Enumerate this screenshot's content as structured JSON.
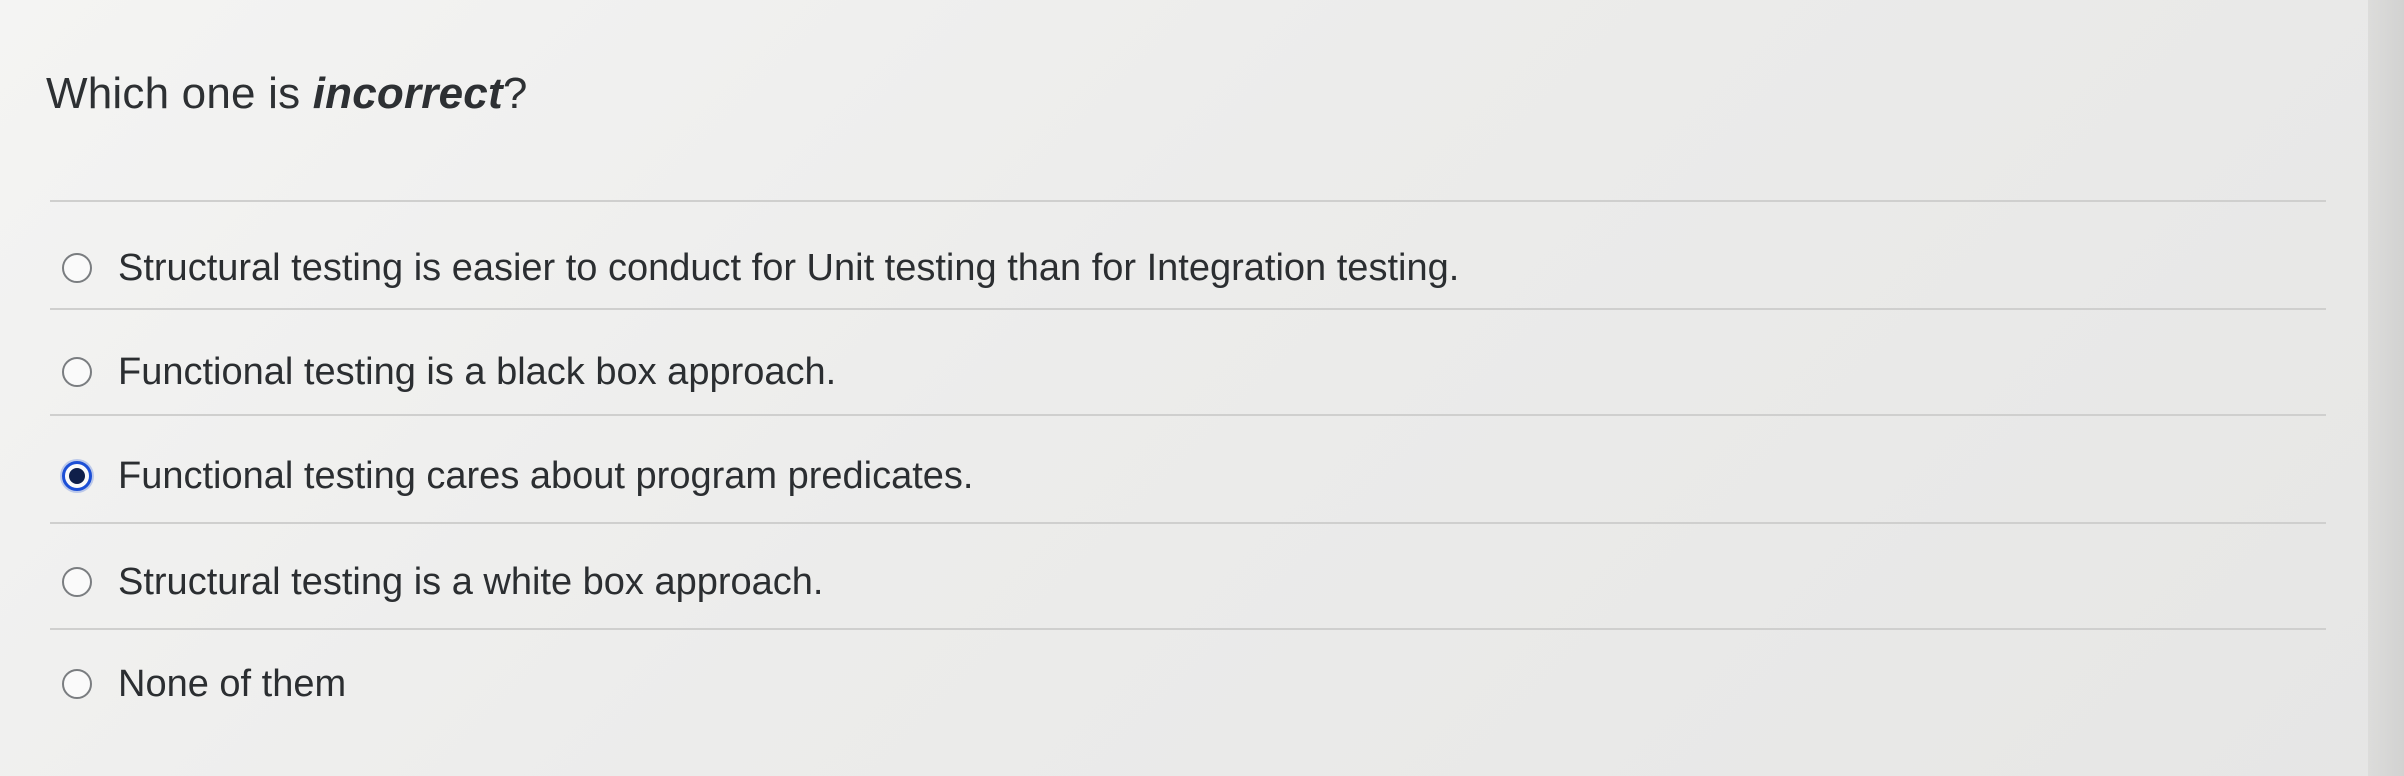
{
  "question": {
    "prefix": "Which one is ",
    "emphasis": "incorrect",
    "suffix": "?"
  },
  "options": [
    {
      "label": "Structural testing is easier to conduct for Unit testing than for Integration testing.",
      "selected": false
    },
    {
      "label": "Functional testing is a black box approach.",
      "selected": false
    },
    {
      "label": "Functional testing cares about program predicates.",
      "selected": true
    },
    {
      "label": "Structural testing is a white box approach.",
      "selected": false
    },
    {
      "label": "None of them",
      "selected": false
    }
  ],
  "colors": {
    "accent": "#1c4fd6",
    "radio_fill": "#0f1f4a",
    "text": "#2d3033"
  }
}
